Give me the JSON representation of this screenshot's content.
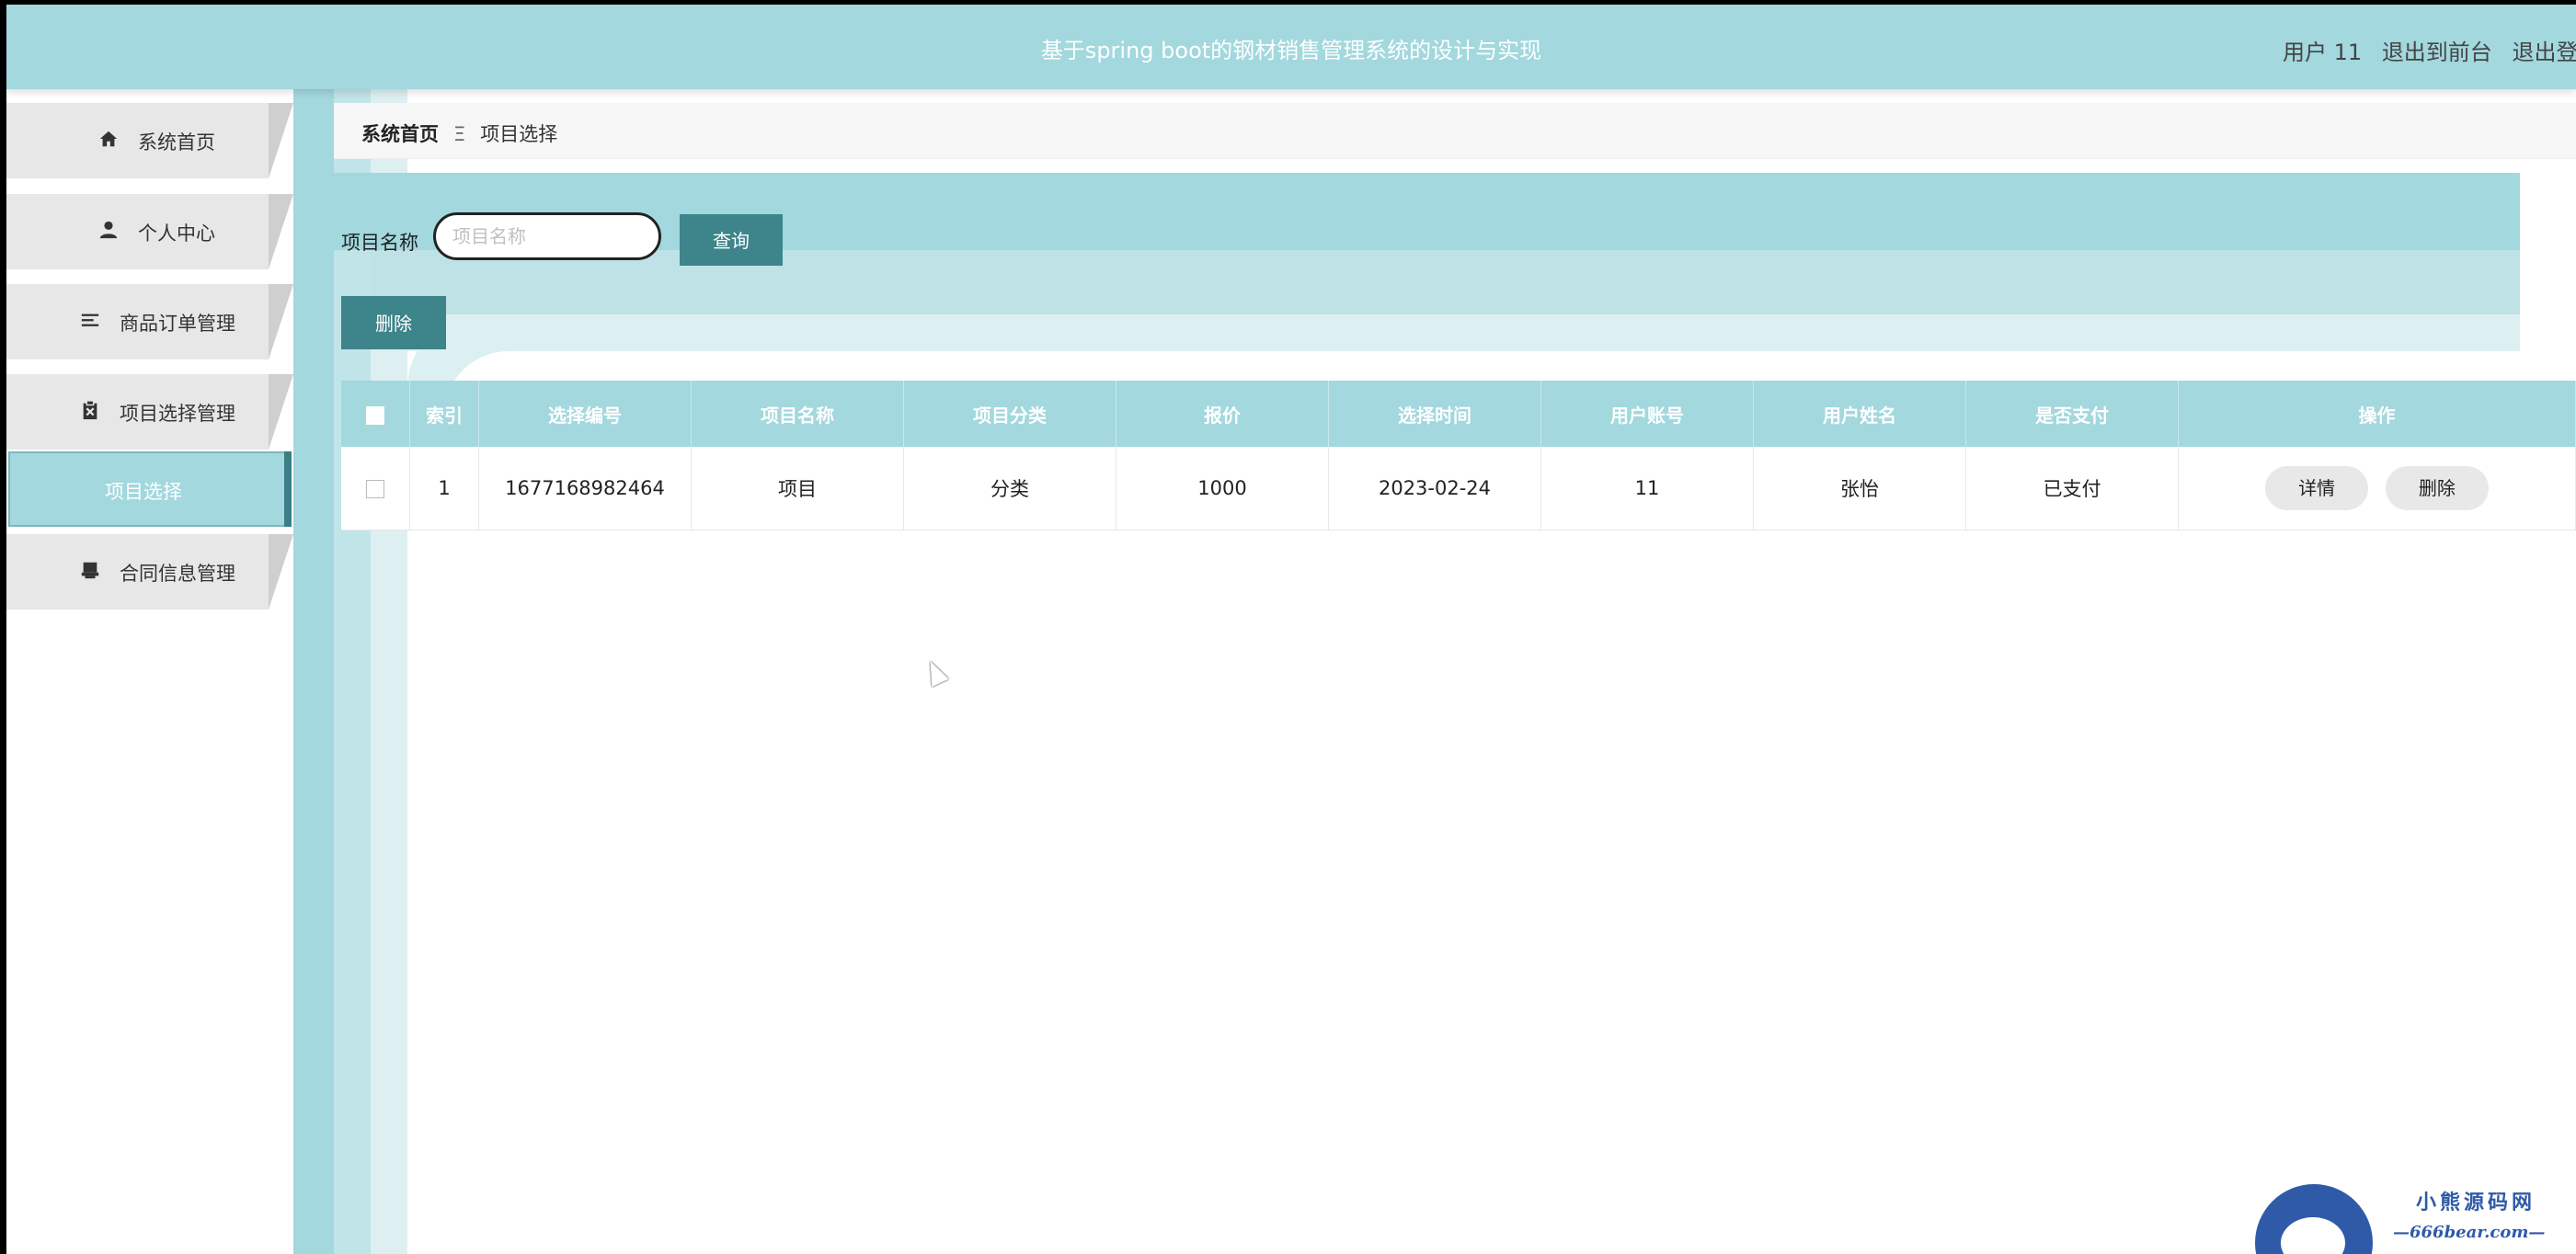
{
  "header": {
    "title": "基于spring boot的钢材销售管理系统的设计与实现",
    "user_label": "用户 11",
    "exit_front": "退出到前台",
    "logout": "退出登录"
  },
  "sidebar": {
    "items": [
      {
        "label": "系统首页",
        "icon": "home-icon"
      },
      {
        "label": "个人中心",
        "icon": "person-icon"
      },
      {
        "label": "商品订单管理",
        "icon": "list-icon"
      },
      {
        "label": "项目选择管理",
        "icon": "clipboard-icon"
      },
      {
        "label": "合同信息管理",
        "icon": "printer-icon"
      }
    ],
    "active_sub": "项目选择"
  },
  "breadcrumb": {
    "home": "系统首页",
    "separator": "Ξ",
    "current": "项目选择"
  },
  "search": {
    "label": "项目名称",
    "placeholder": "项目名称",
    "button": "查询"
  },
  "actions": {
    "delete": "删除"
  },
  "table": {
    "headers": [
      "索引",
      "选择编号",
      "项目名称",
      "项目分类",
      "报价",
      "选择时间",
      "用户账号",
      "用户姓名",
      "是否支付",
      "操作"
    ],
    "rows": [
      {
        "index": "1",
        "select_no": "1677168982464",
        "project_name": "项目",
        "category": "分类",
        "price": "1000",
        "select_time": "2023-02-24",
        "account": "11",
        "name": "张怡",
        "paid": "已支付",
        "detail_btn": "详情",
        "delete_btn": "删除"
      }
    ]
  },
  "watermark": {
    "title": "小熊源码网",
    "url": "—666bear.com—"
  },
  "colors": {
    "accent": "#a2d8de",
    "button": "#3d848b",
    "nav_bg": "#e7e7e7"
  }
}
